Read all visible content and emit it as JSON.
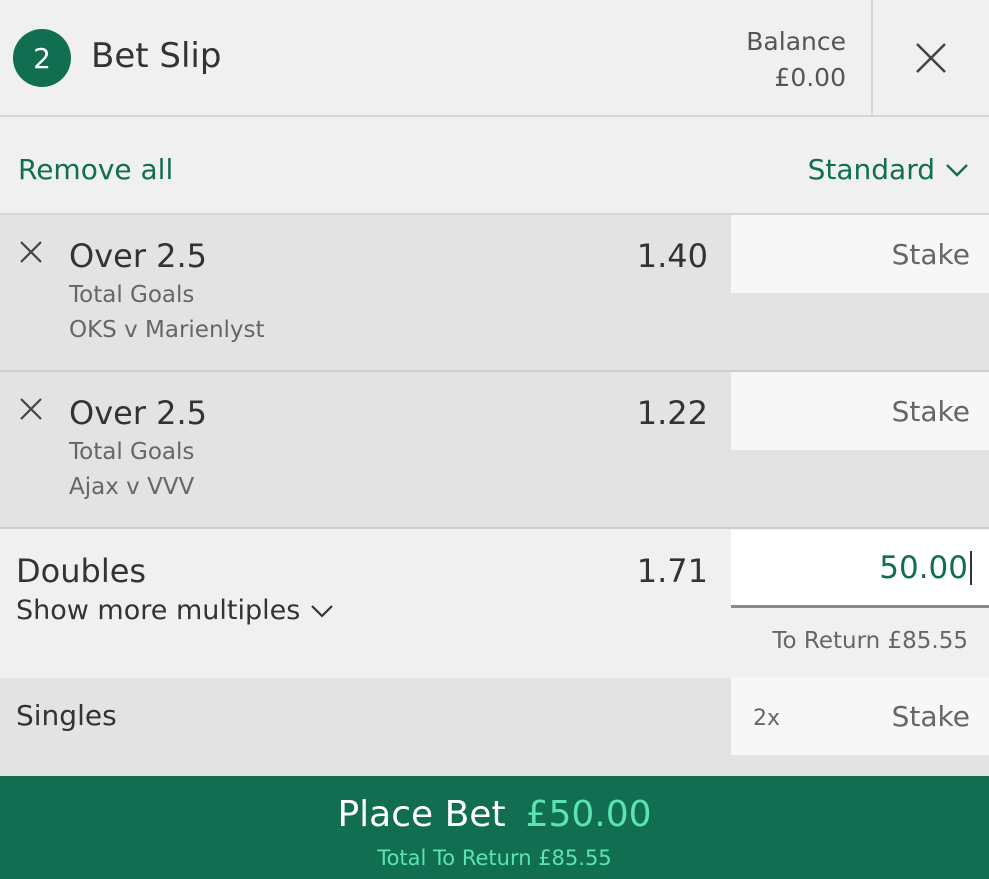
{
  "header": {
    "count": "2",
    "title": "Bet Slip",
    "balance_label": "Balance",
    "balance_value": "£0.00"
  },
  "toolbar": {
    "remove_all": "Remove all",
    "bet_type": "Standard"
  },
  "selections": [
    {
      "name": "Over 2.5",
      "market": "Total Goals",
      "event": "OKS v Marienlyst",
      "odds": "1.40",
      "stake_placeholder": "Stake"
    },
    {
      "name": "Over 2.5",
      "market": "Total Goals",
      "event": "Ajax v VVV",
      "odds": "1.22",
      "stake_placeholder": "Stake"
    }
  ],
  "doubles": {
    "label": "Doubles",
    "show_more": "Show more multiples",
    "odds": "1.71",
    "stake_value": "50.00",
    "to_return": "To Return £85.55"
  },
  "singles": {
    "label": "Singles",
    "multiplier": "2x",
    "stake_placeholder": "Stake"
  },
  "place_bet": {
    "label": "Place Bet",
    "amount": "£50.00",
    "total_return": "Total To Return £85.55"
  },
  "colors": {
    "brand": "#126e51",
    "accent": "#5be3b6"
  },
  "icons": {
    "close": "close-icon",
    "remove": "remove-selection-icon",
    "dropdown": "chevron-down-icon"
  }
}
